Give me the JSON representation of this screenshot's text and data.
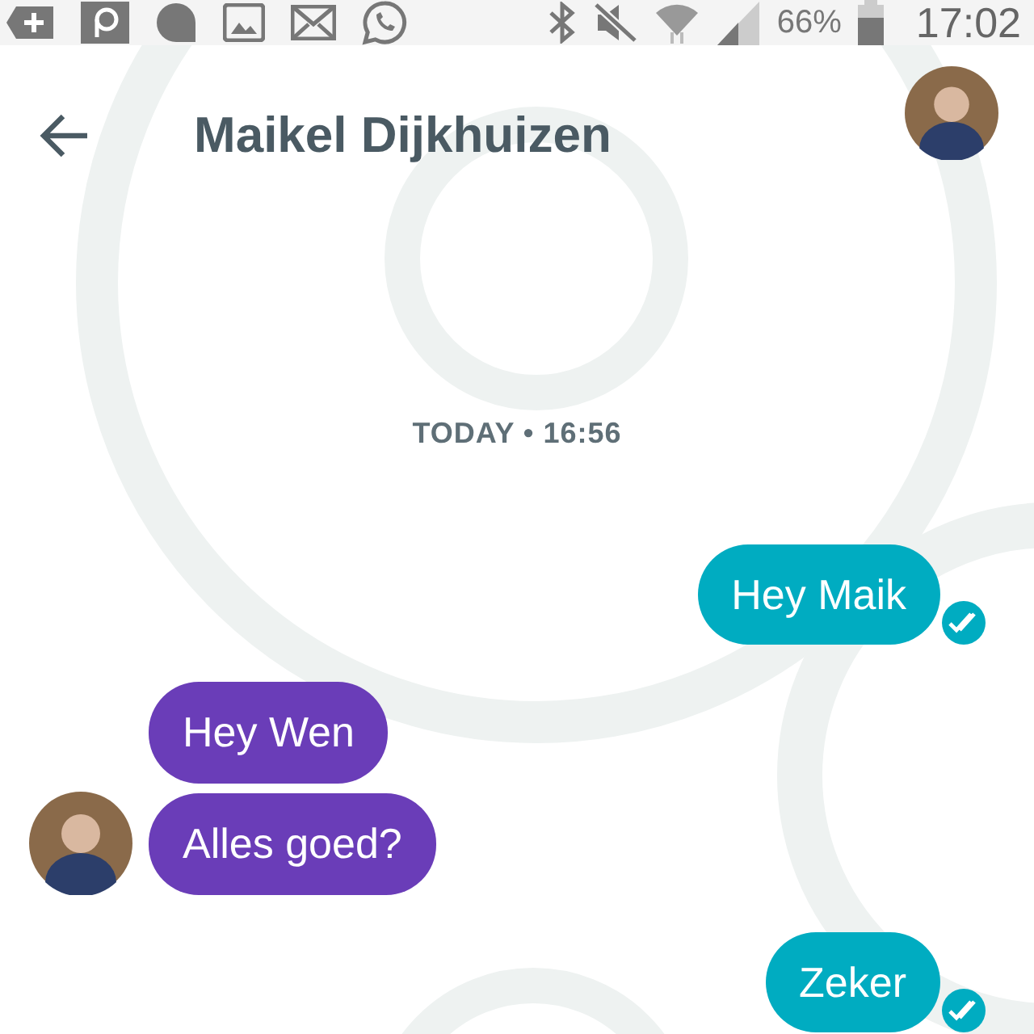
{
  "status_bar": {
    "battery": "66%",
    "time": "17:02"
  },
  "header": {
    "title": "Maikel Dijkhuizen"
  },
  "messages": [
    {
      "kind": "date",
      "text": "TODAY • 16:56"
    },
    {
      "kind": "outgoing",
      "text": "Hey Maik",
      "read": true
    },
    {
      "kind": "incoming",
      "text": "Hey Wen"
    },
    {
      "kind": "incoming",
      "text": "Alles goed?"
    },
    {
      "kind": "outgoing",
      "text": "Zeker",
      "read": true
    }
  ]
}
